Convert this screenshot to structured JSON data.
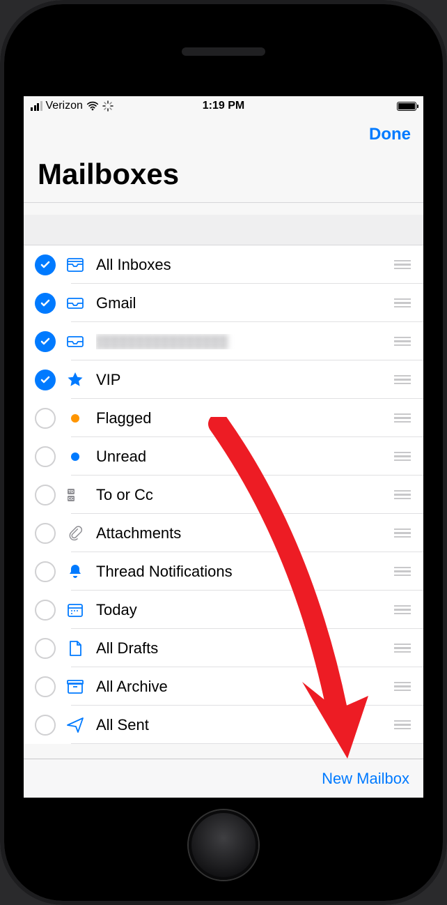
{
  "status": {
    "carrier": "Verizon",
    "time": "1:19 PM"
  },
  "nav": {
    "done": "Done"
  },
  "title": "Mailboxes",
  "toolbar": {
    "new_mailbox": "New Mailbox"
  },
  "rows": [
    {
      "label": "All Inboxes",
      "checked": true,
      "icon": "all-inboxes",
      "color": "#007aff"
    },
    {
      "label": "Gmail",
      "checked": true,
      "icon": "tray",
      "color": "#007aff"
    },
    {
      "label": "",
      "checked": true,
      "icon": "tray",
      "color": "#007aff",
      "redacted": true
    },
    {
      "label": "VIP",
      "checked": true,
      "icon": "star",
      "color": "#007aff"
    },
    {
      "label": "Flagged",
      "checked": false,
      "icon": "dot",
      "color": "#ff9500"
    },
    {
      "label": "Unread",
      "checked": false,
      "icon": "dot",
      "color": "#007aff"
    },
    {
      "label": "To or Cc",
      "checked": false,
      "icon": "tocc",
      "color": "#8e8e93"
    },
    {
      "label": "Attachments",
      "checked": false,
      "icon": "clip",
      "color": "#8e8e93"
    },
    {
      "label": "Thread Notifications",
      "checked": false,
      "icon": "bell",
      "color": "#007aff"
    },
    {
      "label": "Today",
      "checked": false,
      "icon": "calendar",
      "color": "#007aff"
    },
    {
      "label": "All Drafts",
      "checked": false,
      "icon": "doc",
      "color": "#007aff"
    },
    {
      "label": "All Archive",
      "checked": false,
      "icon": "box",
      "color": "#007aff"
    },
    {
      "label": "All Sent",
      "checked": false,
      "icon": "send",
      "color": "#007aff"
    }
  ]
}
